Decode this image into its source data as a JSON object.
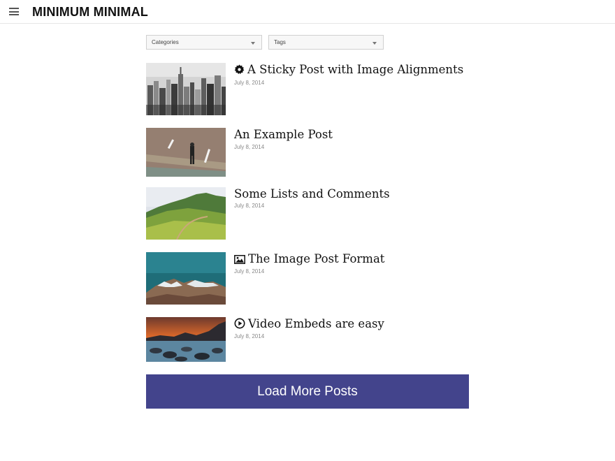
{
  "header": {
    "site_title": "MINIMUM MINIMAL",
    "menu_icon": "hamburger-menu-icon"
  },
  "filters": {
    "categories_label": "Categories",
    "tags_label": "Tags"
  },
  "posts": [
    {
      "title": "A Sticky Post with Image Alignments",
      "date": "July 8, 2014",
      "format_icon": "sticky-badge-icon"
    },
    {
      "title": "An Example Post",
      "date": "July 8, 2014",
      "format_icon": ""
    },
    {
      "title": "Some Lists and Comments",
      "date": "July 8, 2014",
      "format_icon": ""
    },
    {
      "title": "The Image Post Format",
      "date": "July 8, 2014",
      "format_icon": "image-icon"
    },
    {
      "title": "Video Embeds are easy",
      "date": "July 8, 2014",
      "format_icon": "play-circle-icon"
    }
  ],
  "load_more_label": "Load More Posts",
  "colors": {
    "button_bg": "#43448c",
    "button_text": "#ffffff"
  }
}
